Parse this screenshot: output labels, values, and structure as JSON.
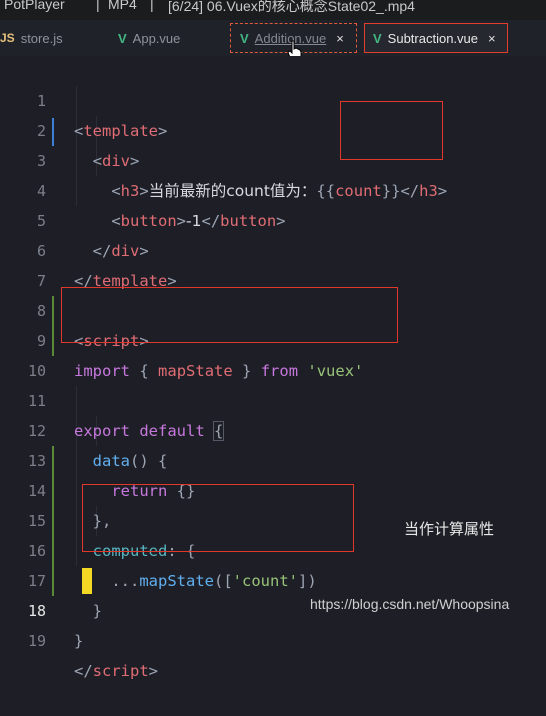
{
  "titlebar": {
    "player": "PotPlayer",
    "separator": "|",
    "format": "MP4",
    "file": "[6/24] 06.Vuex的核心概念State02_.mp4"
  },
  "tabs": [
    {
      "label": "store.js",
      "icon": "js-icon"
    },
    {
      "label": "App.vue",
      "icon": "vue-icon"
    },
    {
      "label": "Addition.vue",
      "icon": "vue-icon",
      "close": "×"
    },
    {
      "label": "Subtraction.vue",
      "icon": "vue-icon",
      "close": "×",
      "active": true
    }
  ],
  "editor": {
    "current_line": "18",
    "lines": [
      {
        "n": "1"
      },
      {
        "n": "2"
      },
      {
        "n": "3"
      },
      {
        "n": "4"
      },
      {
        "n": "5"
      },
      {
        "n": "6"
      },
      {
        "n": "7"
      },
      {
        "n": "8"
      },
      {
        "n": "9"
      },
      {
        "n": "10"
      },
      {
        "n": "11"
      },
      {
        "n": "12"
      },
      {
        "n": "13"
      },
      {
        "n": "14"
      },
      {
        "n": "15"
      },
      {
        "n": "16"
      },
      {
        "n": "17"
      },
      {
        "n": "18"
      },
      {
        "n": "19"
      }
    ],
    "tokens": {
      "template": "template",
      "div": "div",
      "h3": "h3",
      "h3_text": "当前最新的count值为：",
      "mustache_open": "{{",
      "count": "count",
      "mustache_close": "}}",
      "button": "button",
      "button_text": "-1",
      "script": "script",
      "import": "import",
      "brace_open": "{",
      "mapState": "mapState",
      "brace_close": "}",
      "from": "from",
      "vuex": "'vuex'",
      "export": "export",
      "default": "default",
      "data": "data",
      "parens": "()",
      "return": "return",
      "empty_obj": "{}",
      "close_comma": "},",
      "computed": "computed",
      "spread": "...",
      "count_str": "'count'",
      "close_brace": "}"
    }
  },
  "annotation": "当作计算属性",
  "watermark": "https://blog.csdn.net/Whoopsina",
  "colors": {
    "background": "#1e1f26",
    "highlight_box": "#e0392b",
    "cursor": "#f3d923",
    "vue_green": "#41b883"
  }
}
